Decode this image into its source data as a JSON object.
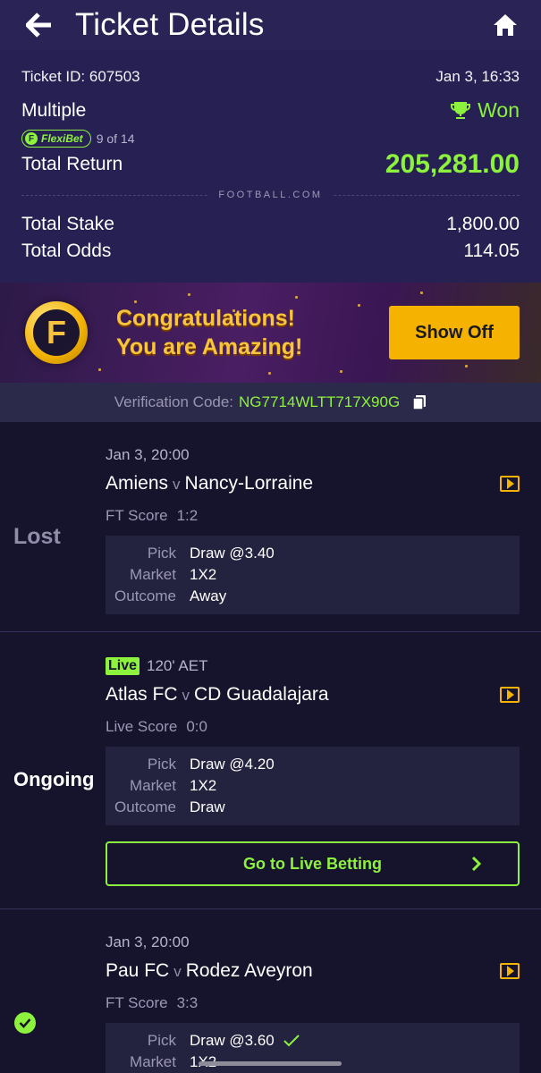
{
  "header": {
    "title": "Ticket Details"
  },
  "ticket": {
    "id_label": "Ticket ID: 607503",
    "datetime": "Jan 3, 16:33",
    "type": "Multiple",
    "result": "Won",
    "flexibet_label": "FlexiBet",
    "flexibet_count": "9 of 14",
    "total_return_label": "Total Return",
    "total_return_value": "205,281.00",
    "watermark": "FOOTBALL.COM",
    "total_stake_label": "Total Stake",
    "total_stake_value": "1,800.00",
    "total_odds_label": "Total Odds",
    "total_odds_value": "114.05"
  },
  "banner": {
    "line1": "Congratulations!",
    "line2": "You are Amazing!",
    "button": "Show Off",
    "accent": "#f5b300"
  },
  "verification": {
    "label": "Verification Code:",
    "code": "NG7714WLTT717X90G"
  },
  "events": [
    {
      "status": "Lost",
      "date": "Jan 3, 20:00",
      "home": "Amiens",
      "vs": "v",
      "away": "Nancy-Lorraine",
      "score_label": "FT Score",
      "score": "1:2",
      "pick_label": "Pick",
      "pick": "Draw @3.40",
      "market_label": "Market",
      "market": "1X2",
      "outcome_label": "Outcome",
      "outcome": "Away"
    },
    {
      "status": "Ongoing",
      "live_tag": "Live",
      "live_time": "120' AET",
      "home": "Atlas FC",
      "vs": "v",
      "away": "CD Guadalajara",
      "score_label": "Live Score",
      "score": "0:0",
      "pick_label": "Pick",
      "pick": "Draw @4.20",
      "market_label": "Market",
      "market": "1X2",
      "outcome_label": "Outcome",
      "outcome": "Draw",
      "live_button": "Go to Live Betting"
    },
    {
      "status_icon": "check-circle-icon",
      "date": "Jan 3, 20:00",
      "home": "Pau FC",
      "vs": "v",
      "away": "Rodez Aveyron",
      "score_label": "FT Score",
      "score": "3:3",
      "pick_label": "Pick",
      "pick": "Draw @3.60",
      "market_label": "Market",
      "market": "1X2"
    }
  ],
  "colors": {
    "green": "#8cf23d",
    "header_bg": "#2a2456",
    "page_bg": "#15142c"
  }
}
